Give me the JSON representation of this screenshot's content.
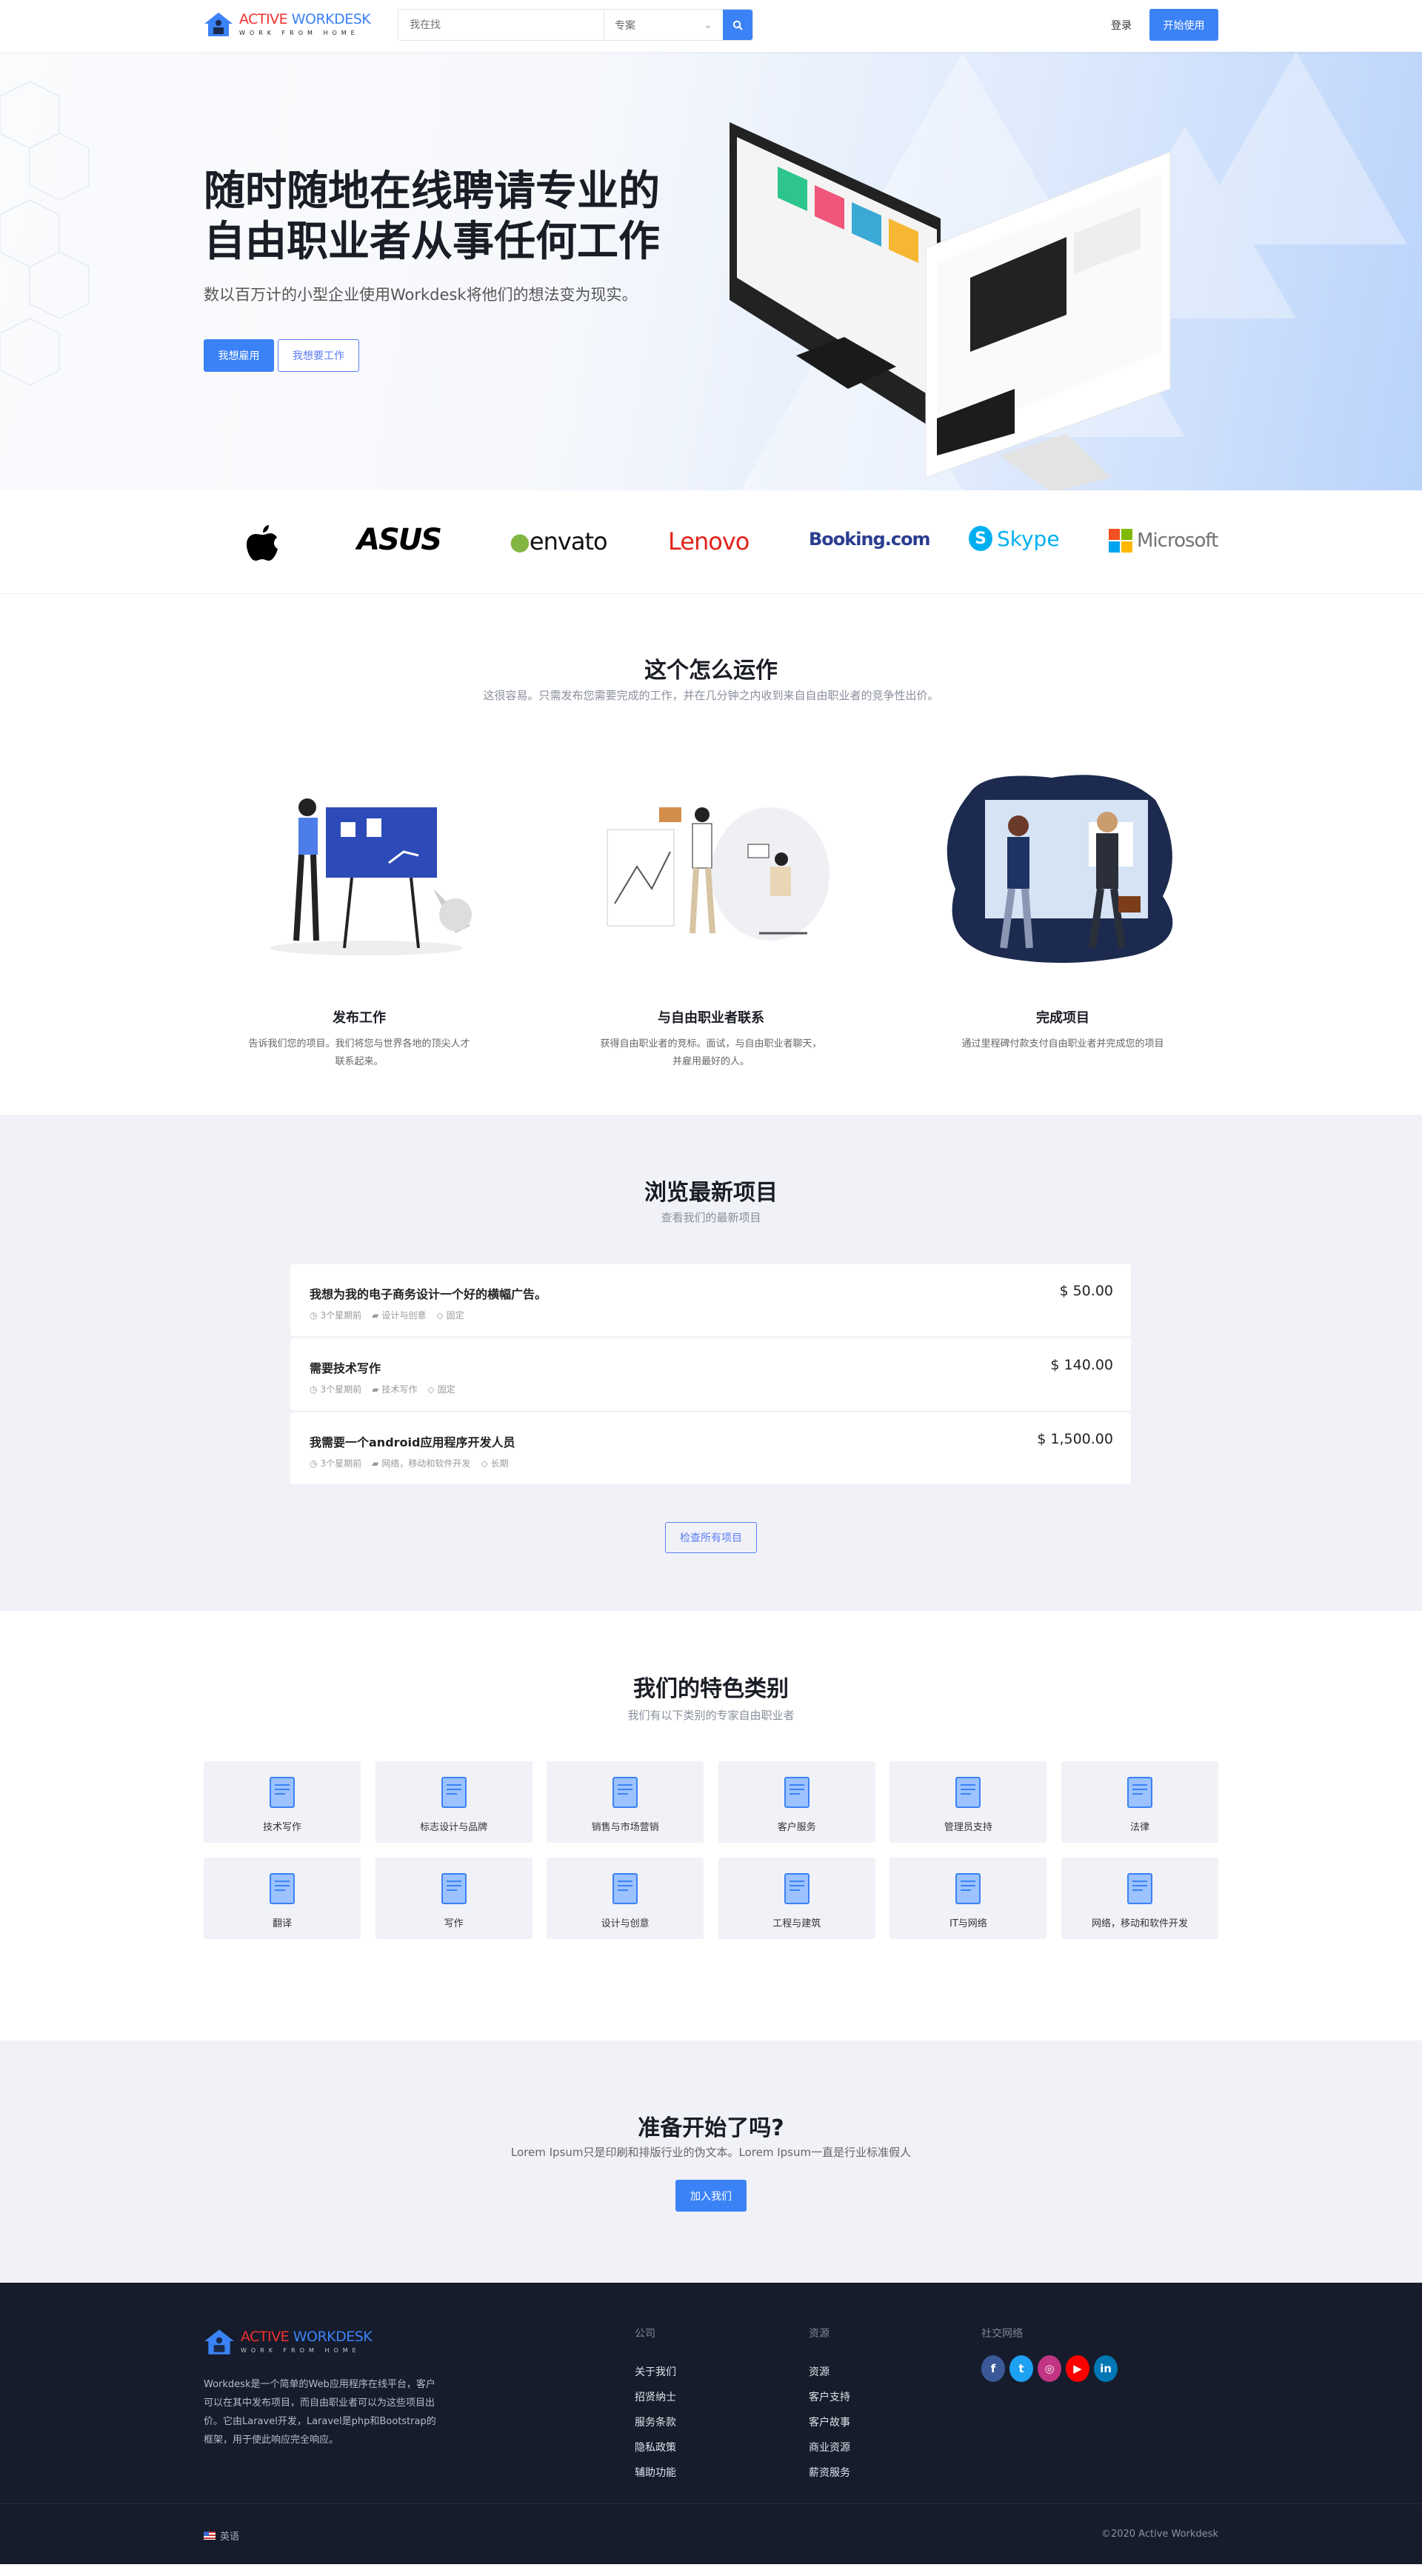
{
  "brand": {
    "name_red": "ACTIVE",
    "name_blue": "WORKDESK",
    "tagline": "WORK FROM HOME"
  },
  "header": {
    "search_placeholder": "我在找",
    "search_type": "专案",
    "login": "登录",
    "get_started": "开始使用"
  },
  "hero": {
    "title_line1": "随时随地在线聘请专业的",
    "title_line2": "自由职业者从事任何工作",
    "subtitle": "数以百万计的小型企业使用Workdesk将他们的想法变为现实。",
    "hire_button": "我想雇用",
    "work_button": "我想要工作"
  },
  "partners": [
    "apple",
    "ASUS",
    "envato",
    "Lenovo",
    "Booking.com",
    "Skype",
    "Microsoft"
  ],
  "how": {
    "title": "这个怎么运作",
    "subtitle": "这很容易。只需发布您需要完成的工作，并在几分钟之内收到来自自由职业者的竞争性出价。",
    "steps": [
      {
        "title": "发布工作",
        "desc": "告诉我们您的项目。我们将您与世界各地的顶尖人才联系起来。"
      },
      {
        "title": "与自由职业者联系",
        "desc": "获得自由职业者的竞标。面试，与自由职业者聊天，并雇用最好的人。"
      },
      {
        "title": "完成项目",
        "desc": "通过里程碑付款支付自由职业者并完成您的项目"
      }
    ]
  },
  "projects": {
    "title": "浏览最新项目",
    "subtitle": "查看我们的最新项目",
    "view_all": "检查所有项目",
    "items": [
      {
        "title": "我想为我的电子商务设计一个好的横幅广告。",
        "price": "$ 50.00",
        "time": "3个星期前",
        "category": "设计与创意",
        "type": "固定"
      },
      {
        "title": "需要技术写作",
        "price": "$ 140.00",
        "time": "3个星期前",
        "category": "技术写作",
        "type": "固定"
      },
      {
        "title": "我需要一个android应用程序开发人员",
        "price": "$ 1,500.00",
        "time": "3个星期前",
        "category": "网络，移动和软件开发",
        "type": "长期"
      }
    ]
  },
  "categories": {
    "title": "我们的特色类别",
    "subtitle": "我们有以下类别的专家自由职业者",
    "items": [
      "技术写作",
      "标志设计与品牌",
      "销售与市场营销",
      "客户服务",
      "管理员支持",
      "法律",
      "翻译",
      "写作",
      "设计与创意",
      "工程与建筑",
      "IT与网络",
      "网络，移动和软件开发"
    ]
  },
  "cta": {
    "title": "准备开始了吗?",
    "subtitle": "Lorem Ipsum只是印刷和排版行业的伪文本。Lorem Ipsum一直是行业标准假人",
    "button": "加入我们"
  },
  "footer": {
    "about": "Workdesk是一个简单的Web应用程序在线平台，客户可以在其中发布项目，而自由职业者可以为这些项目出价。它由Laravel开发，Laravel是php和Bootstrap的框架，用于使此响应完全响应。",
    "company_heading": "公司",
    "company_links": [
      "关于我们",
      "招贤纳士",
      "服务条款",
      "隐私政策",
      "辅助功能"
    ],
    "resources_heading": "资源",
    "resources_links": [
      "资源",
      "客户支持",
      "客户故事",
      "商业资源",
      "薪资服务"
    ],
    "social_heading": "社交网络",
    "social": [
      {
        "name": "facebook",
        "color": "#3b5998"
      },
      {
        "name": "twitter",
        "color": "#1da1f2"
      },
      {
        "name": "instagram",
        "color": "#c13584"
      },
      {
        "name": "youtube",
        "color": "#ff0000"
      },
      {
        "name": "linkedin",
        "color": "#0077b5"
      }
    ],
    "language": "英语",
    "copyright": "©2020 Active Workdesk"
  },
  "colors": {
    "accent": "#3b82f6",
    "footer_bg": "#161c2b",
    "section_gray": "#f1f2f7"
  }
}
